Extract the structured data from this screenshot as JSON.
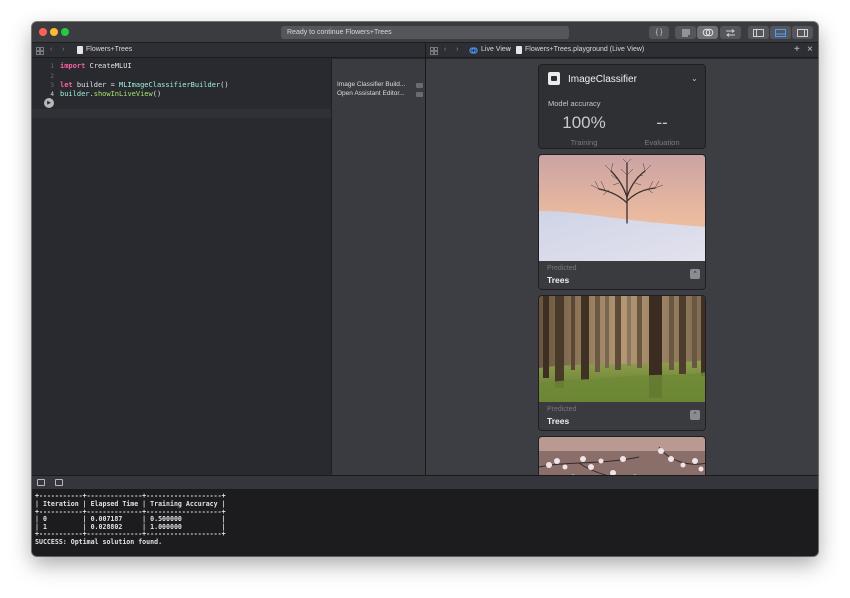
{
  "toolbar": {
    "activity_text": "Ready to continue Flowers+Trees",
    "braces_label": "{ }",
    "icons": [
      "library-icon",
      "standard-editor-icon",
      "assistant-editor-icon",
      "version-editor-icon",
      "navigator-toggle-icon",
      "debug-toggle-icon",
      "inspector-toggle-icon"
    ]
  },
  "left_jumpbar": {
    "file": "Flowers+Trees"
  },
  "right_jumpbar": {
    "crumb1": "Live View",
    "crumb2": "Flowers+Trees.playground (Live View)",
    "add_label": "+",
    "close_label": "×"
  },
  "editor": {
    "line_numbers": [
      "1",
      "2",
      "3",
      "4"
    ],
    "line1_kw": "import",
    "line1_rest": " CreateMLUI",
    "line3_kw": "let",
    "line3_mid": " builder = ",
    "line3_type": "MLImageClassifierBuilder",
    "line3_end": "()",
    "line4_var": "builder",
    "line4_dot": ".",
    "line4_fn": "showInLiveView",
    "line4_end": "()"
  },
  "results": {
    "row1": "Image Classifier Build...",
    "row2": "Open Assistant Editor..."
  },
  "classifier": {
    "title": "ImageClassifier",
    "accuracy_label": "Model accuracy",
    "training_value": "100%",
    "training_label": "Training",
    "evaluation_value": "--",
    "evaluation_label": "Evaluation"
  },
  "predictions": [
    {
      "label": "Predicted",
      "value": "Trees"
    },
    {
      "label": "Predicted",
      "value": "Trees"
    }
  ],
  "console": {
    "border": "+-----------+--------------+-------------------+",
    "header": "| Iteration | Elapsed Time | Training Accuracy |",
    "row1": "| 0         | 0.007187     | 0.500000          |",
    "row2": "| 1         | 0.028802     | 1.000000          |",
    "success": "SUCCESS: Optimal solution found."
  }
}
